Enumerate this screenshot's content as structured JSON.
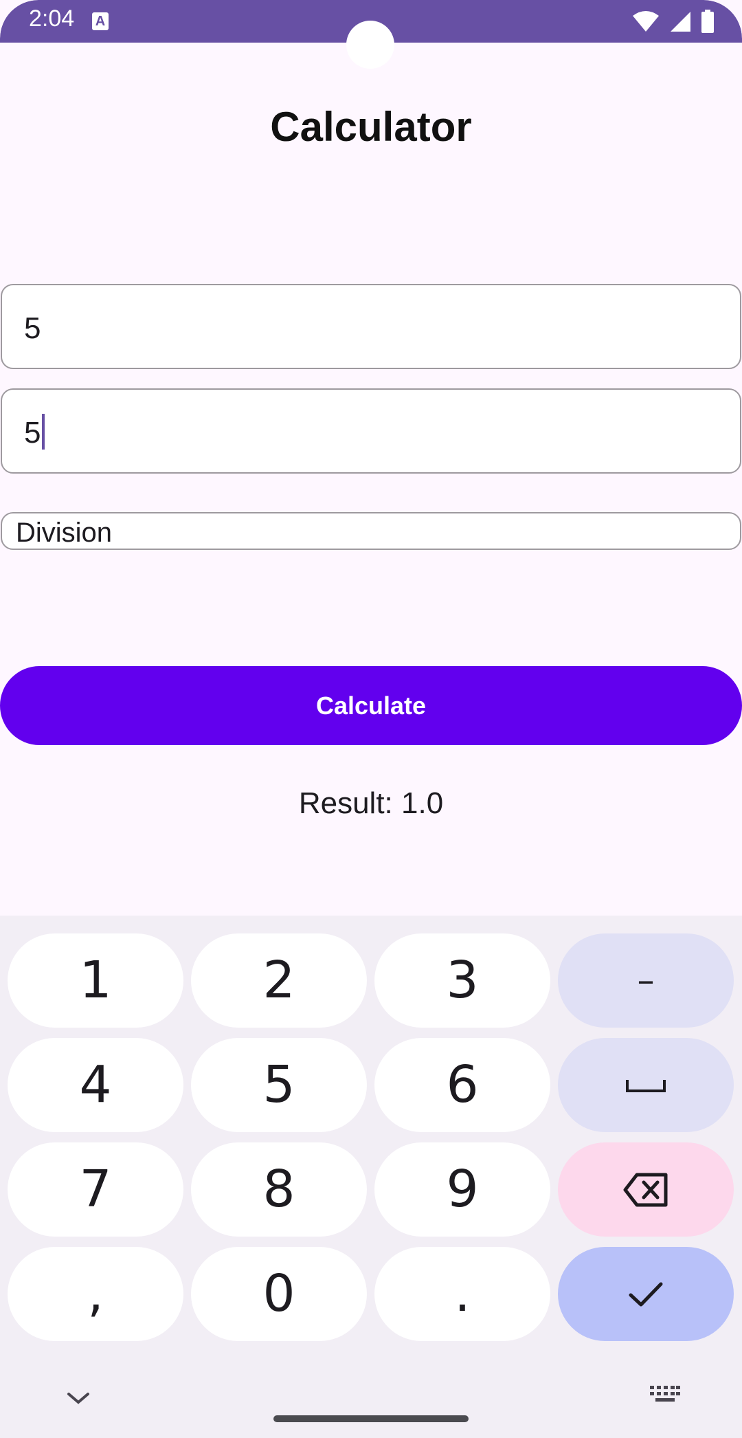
{
  "status_bar": {
    "time": "2:04",
    "notification_icon": "a-icon",
    "icons": [
      "wifi-icon",
      "cell-signal-icon",
      "battery-icon"
    ]
  },
  "page": {
    "title": "Calculator"
  },
  "inputs": {
    "first_number": "5",
    "second_number": "5"
  },
  "operation": {
    "selected": "Division"
  },
  "button": {
    "calculate_label": "Calculate"
  },
  "result": {
    "text": "Result: 1.0"
  },
  "keyboard": {
    "keys": [
      "1",
      "2",
      "3",
      "–",
      "4",
      "5",
      "6",
      "space",
      "7",
      "8",
      "9",
      "backspace",
      ",",
      "0",
      ".",
      "done"
    ],
    "labels": {
      "k1": "1",
      "k2": "2",
      "k3": "3",
      "minus": "–",
      "k4": "4",
      "k5": "5",
      "k6": "6",
      "k7": "7",
      "k8": "8",
      "k9": "9",
      "comma": ",",
      "k0": "0",
      "period": "."
    }
  },
  "colors": {
    "status_bar": "#6750A4",
    "background": "#FEF7FF",
    "button": "#6200EE",
    "keyboard_bg": "#F2EEF5",
    "key_function": "#E0E0F5",
    "key_delete": "#FDD8EC",
    "key_done": "#B8C1F9"
  }
}
